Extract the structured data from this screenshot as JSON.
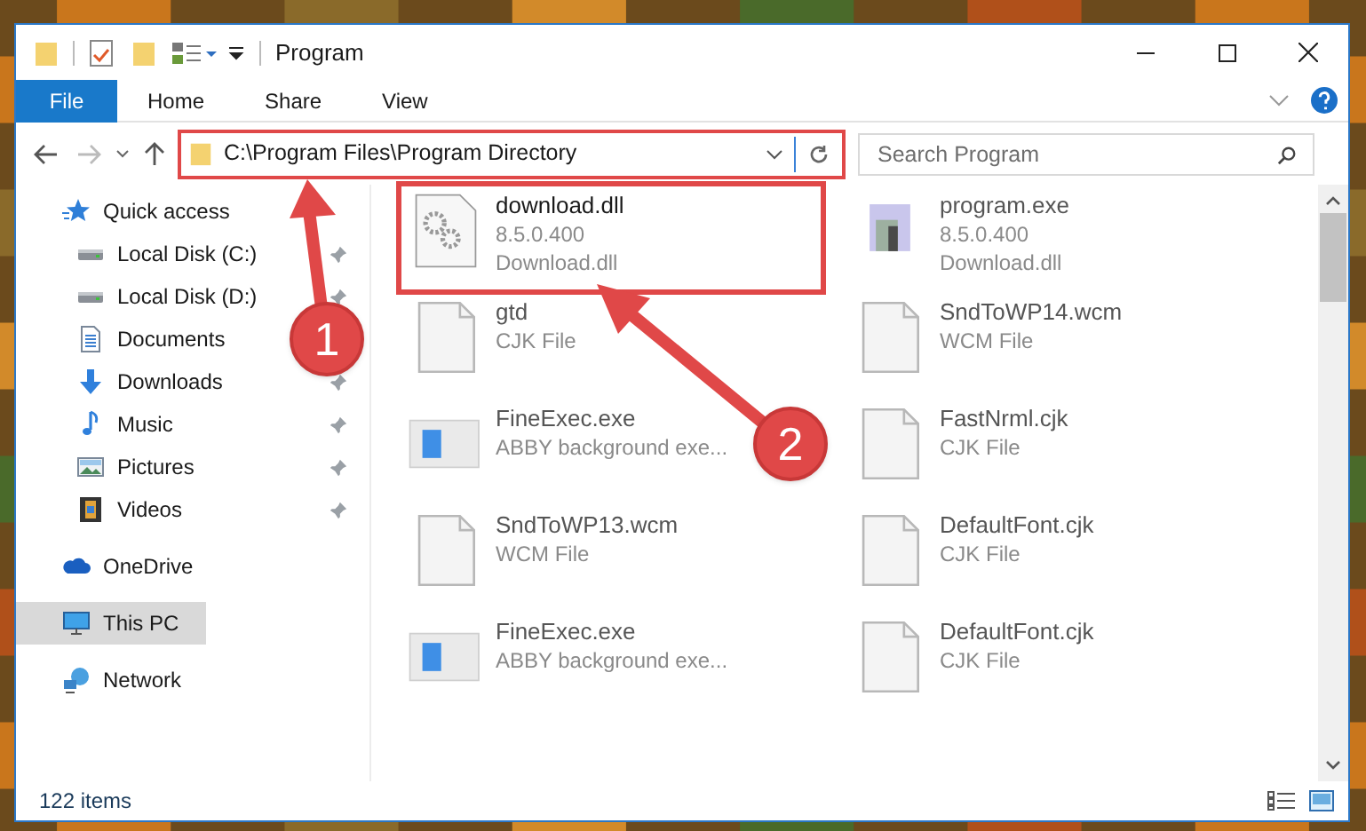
{
  "window": {
    "title": "Program"
  },
  "ribbon": {
    "tabs": [
      {
        "label": "File",
        "selected": true
      },
      {
        "label": "Home",
        "selected": false
      },
      {
        "label": "Share",
        "selected": false
      },
      {
        "label": "View",
        "selected": false
      }
    ]
  },
  "address": {
    "path": "C:\\Program Files\\Program Directory",
    "highlighted": true
  },
  "search": {
    "placeholder": "Search Program"
  },
  "sidebar": {
    "items": [
      {
        "label": "Quick access",
        "kind": "star",
        "selected": false,
        "children": [
          {
            "label": "Local Disk (C:)",
            "kind": "drive",
            "pinned": true,
            "selected": false
          },
          {
            "label": "Local Disk (D:)",
            "kind": "drive",
            "pinned": true,
            "selected": false
          },
          {
            "label": "Documents",
            "kind": "documents",
            "pinned": false,
            "selected": false
          },
          {
            "label": "Downloads",
            "kind": "downloads",
            "pinned": true,
            "selected": false
          },
          {
            "label": "Music",
            "kind": "music",
            "pinned": true,
            "selected": false
          },
          {
            "label": "Pictures",
            "kind": "pictures",
            "pinned": true,
            "selected": false
          },
          {
            "label": "Videos",
            "kind": "videos",
            "pinned": true,
            "selected": false
          }
        ]
      },
      {
        "label": "OneDrive",
        "kind": "cloud",
        "selected": false
      },
      {
        "label": "This PC",
        "kind": "pc",
        "selected": true
      },
      {
        "label": "Network",
        "kind": "network",
        "selected": false
      }
    ]
  },
  "files": {
    "columns": [
      {
        "items": [
          {
            "kind": "dll",
            "name": "download.dll",
            "lines": [
              "8.5.0.400",
              "Download.dll"
            ],
            "selected": true
          },
          {
            "kind": "blank",
            "name": "gtd",
            "lines": [
              "CJK File"
            ],
            "selected": false
          },
          {
            "kind": "window",
            "name": "FineExec.exe",
            "lines": [
              "ABBY background exe..."
            ],
            "selected": false
          },
          {
            "kind": "blank",
            "name": "SndToWP13.wcm",
            "lines": [
              "WCM File"
            ],
            "selected": false
          },
          {
            "kind": "window",
            "name": "FineExec.exe",
            "lines": [
              "ABBY background exe..."
            ],
            "selected": false
          }
        ]
      },
      {
        "items": [
          {
            "kind": "program",
            "name": "program.exe",
            "lines": [
              "8.5.0.400",
              "Download.dll"
            ],
            "selected": false
          },
          {
            "kind": "blank",
            "name": "SndToWP14.wcm",
            "lines": [
              "WCM File"
            ],
            "selected": false
          },
          {
            "kind": "blank",
            "name": "FastNrml.cjk",
            "lines": [
              "CJK File"
            ],
            "selected": false
          },
          {
            "kind": "blank",
            "name": "DefaultFont.cjk",
            "lines": [
              "CJK File"
            ],
            "selected": false
          },
          {
            "kind": "blank",
            "name": "DefaultFont.cjk",
            "lines": [
              "CJK File"
            ],
            "selected": false
          }
        ]
      }
    ]
  },
  "status_bar": {
    "count": "122 items"
  },
  "callouts": [
    {
      "label": "1"
    },
    {
      "label": "2"
    }
  ]
}
